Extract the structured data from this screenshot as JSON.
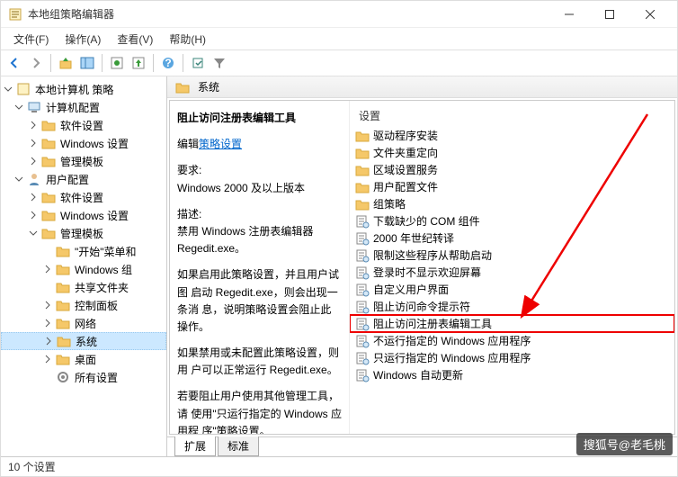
{
  "window": {
    "title": "本地组策略编辑器"
  },
  "menubar": [
    "文件(F)",
    "操作(A)",
    "查看(V)",
    "帮助(H)"
  ],
  "tree": [
    {
      "label": "本地计算机 策略",
      "indent": 0,
      "icon": "scroll",
      "toggle": "down"
    },
    {
      "label": "计算机配置",
      "indent": 1,
      "icon": "computer",
      "toggle": "down"
    },
    {
      "label": "软件设置",
      "indent": 2,
      "icon": "folder",
      "toggle": "right"
    },
    {
      "label": "Windows 设置",
      "indent": 2,
      "icon": "folder",
      "toggle": "right"
    },
    {
      "label": "管理模板",
      "indent": 2,
      "icon": "folder",
      "toggle": "right"
    },
    {
      "label": "用户配置",
      "indent": 1,
      "icon": "user",
      "toggle": "down"
    },
    {
      "label": "软件设置",
      "indent": 2,
      "icon": "folder",
      "toggle": "right"
    },
    {
      "label": "Windows 设置",
      "indent": 2,
      "icon": "folder",
      "toggle": "right"
    },
    {
      "label": "管理模板",
      "indent": 2,
      "icon": "folder",
      "toggle": "down"
    },
    {
      "label": "\"开始\"菜单和",
      "indent": 3,
      "icon": "folder",
      "toggle": "none"
    },
    {
      "label": "Windows 组",
      "indent": 3,
      "icon": "folder",
      "toggle": "right"
    },
    {
      "label": "共享文件夹",
      "indent": 3,
      "icon": "folder",
      "toggle": "none"
    },
    {
      "label": "控制面板",
      "indent": 3,
      "icon": "folder",
      "toggle": "right"
    },
    {
      "label": "网络",
      "indent": 3,
      "icon": "folder",
      "toggle": "right"
    },
    {
      "label": "系统",
      "indent": 3,
      "icon": "folder",
      "toggle": "right",
      "selected": true
    },
    {
      "label": "桌面",
      "indent": 3,
      "icon": "folder",
      "toggle": "right"
    },
    {
      "label": "所有设置",
      "indent": 3,
      "icon": "settings",
      "toggle": "none"
    }
  ],
  "details": {
    "header": "系统",
    "title": "阻止访问注册表编辑工具",
    "edit_prefix": "编辑",
    "edit_link": "策略设置",
    "req_label": "要求:",
    "req_text": "Windows 2000 及以上版本",
    "desc_label": "描述:",
    "desc_p1": "禁用 Windows 注册表编辑器 Regedit.exe。",
    "desc_p2": "如果启用此策略设置，并且用户试图 启动 Regedit.exe，则会出现一条消 息，说明策略设置会阻止此操作。",
    "desc_p3": "如果禁用或未配置此策略设置，则用 户可以正常运行 Regedit.exe。",
    "desc_p4": "若要阻止用户使用其他管理工具，请 使用\"只运行指定的 Windows 应用程 序\"策略设置。"
  },
  "list_header": "设置",
  "list": [
    {
      "label": "驱动程序安装",
      "icon": "folder"
    },
    {
      "label": "文件夹重定向",
      "icon": "folder"
    },
    {
      "label": "区域设置服务",
      "icon": "folder"
    },
    {
      "label": "用户配置文件",
      "icon": "folder"
    },
    {
      "label": "组策略",
      "icon": "folder"
    },
    {
      "label": "下载缺少的 COM 组件",
      "icon": "setting"
    },
    {
      "label": "2000 年世纪转译",
      "icon": "setting"
    },
    {
      "label": "限制这些程序从帮助启动",
      "icon": "setting"
    },
    {
      "label": "登录时不显示欢迎屏幕",
      "icon": "setting"
    },
    {
      "label": "自定义用户界面",
      "icon": "setting"
    },
    {
      "label": "阻止访问命令提示符",
      "icon": "setting"
    },
    {
      "label": "阻止访问注册表编辑工具",
      "icon": "setting",
      "highlighted": true
    },
    {
      "label": "不运行指定的 Windows 应用程序",
      "icon": "setting"
    },
    {
      "label": "只运行指定的 Windows 应用程序",
      "icon": "setting"
    },
    {
      "label": "Windows 自动更新",
      "icon": "setting"
    }
  ],
  "tabs": {
    "extended": "扩展",
    "standard": "标准"
  },
  "status": "10 个设置",
  "watermark": "搜狐号@老毛桃"
}
